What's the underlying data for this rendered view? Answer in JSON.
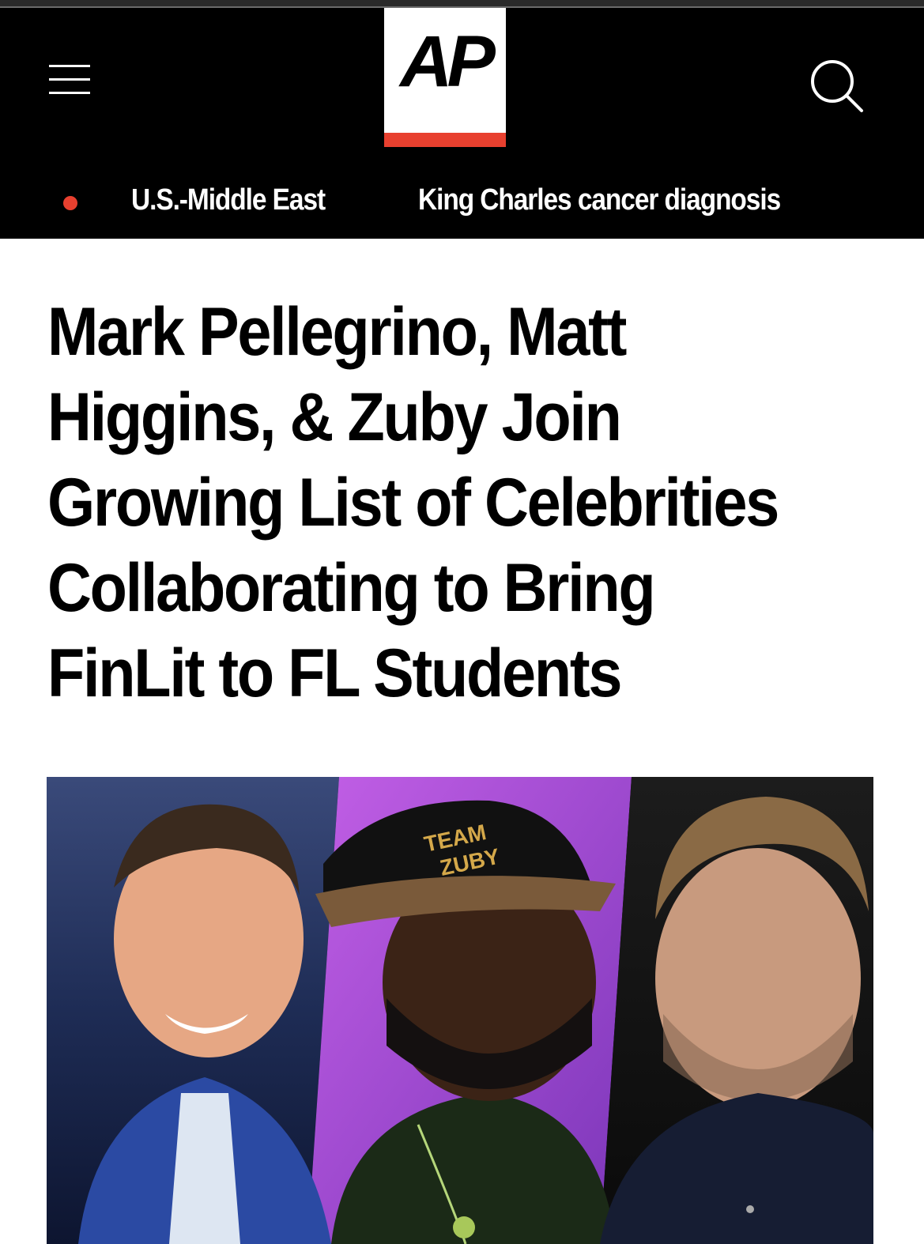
{
  "header": {
    "logo_text": "AP",
    "menu_icon": "hamburger-menu-icon",
    "search_icon": "search-icon",
    "brand_red": "#e8402f",
    "background": "#000000"
  },
  "trending": {
    "live_indicator_color": "#e8402f",
    "items": [
      {
        "label": "U.S.-Middle East"
      },
      {
        "label": "King Charles cancer diagnosis"
      }
    ]
  },
  "article": {
    "headline": "Mark Pellegrino, Matt Higgins, & Zuby Join Growing List of Celebrities Collaborating to Bring FinLit to FL Students",
    "hero_image": {
      "cap_text": "TEAM ZUBY"
    }
  }
}
